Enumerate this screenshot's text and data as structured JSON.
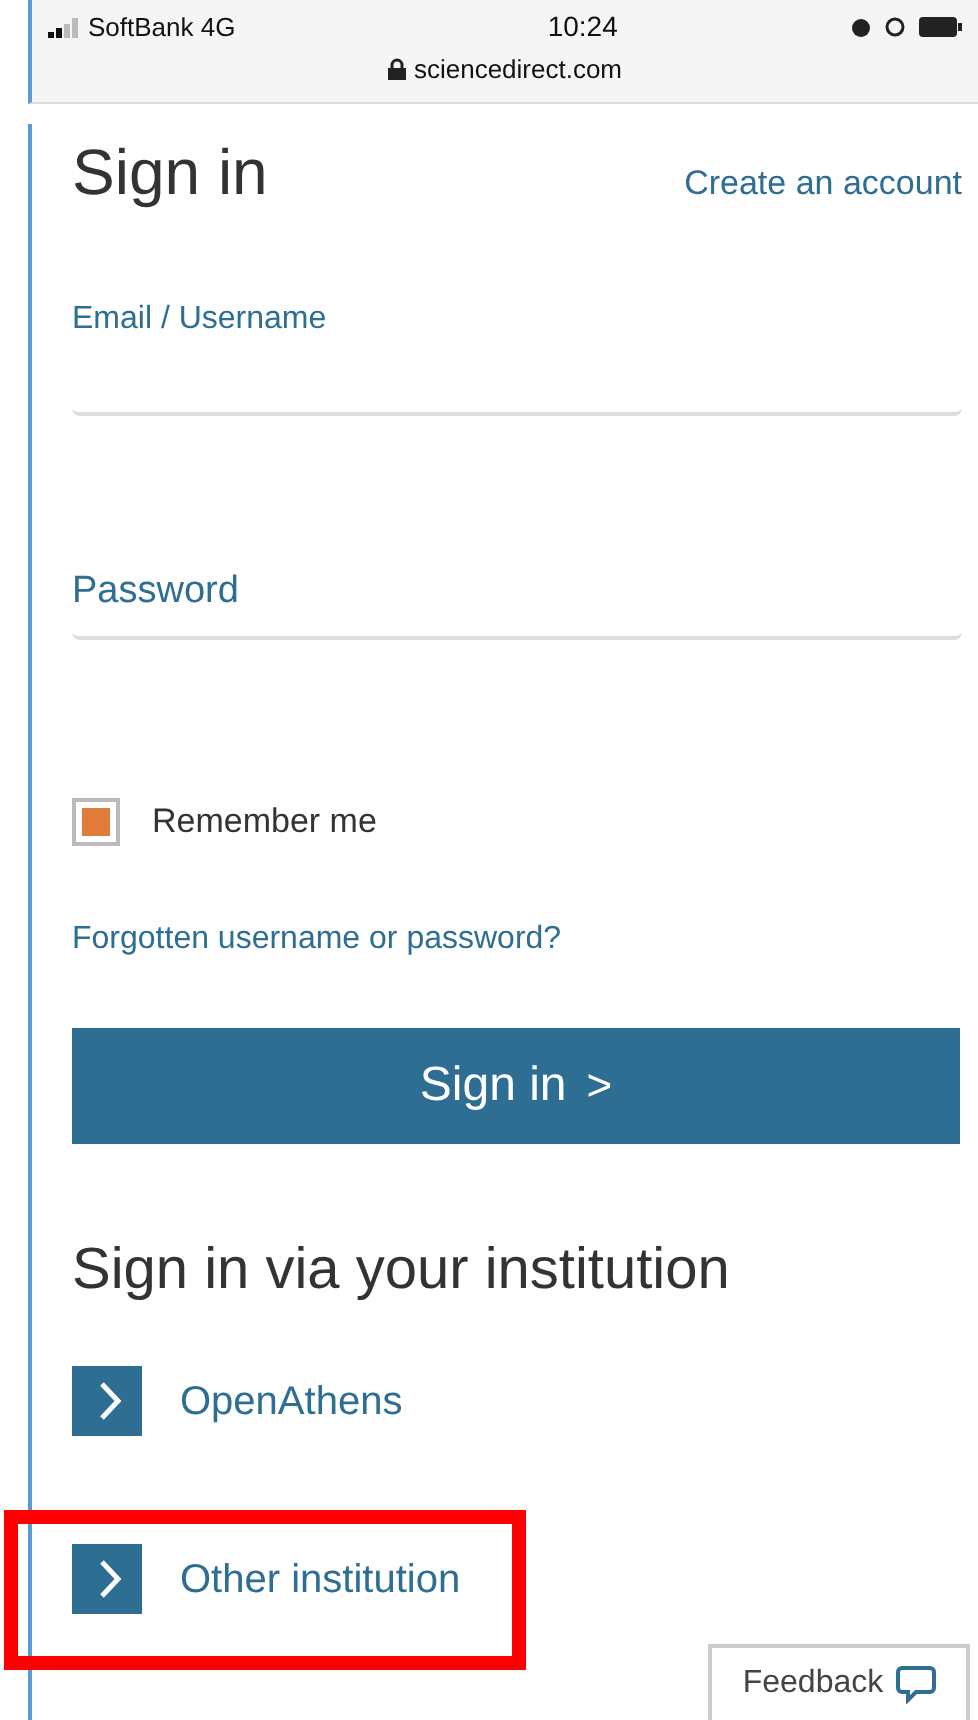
{
  "status_bar": {
    "carrier": "SoftBank 4G",
    "time": "10:24",
    "url": "sciencedirect.com"
  },
  "title": "Sign in",
  "create_account": "Create an account",
  "fields": [
    {
      "label": "Email / Username",
      "kind": "email"
    },
    {
      "label": "Password",
      "kind": "password"
    }
  ],
  "remember": {
    "label": "Remember me",
    "checked": true
  },
  "forgot": "Forgotten username or password?",
  "submit": {
    "label": "Sign in",
    "arrow": ">"
  },
  "institution_heading": "Sign in via your institution",
  "institutions": [
    {
      "label": "OpenAthens",
      "highlighted": false
    },
    {
      "label": "Other institution",
      "highlighted": true
    }
  ],
  "feedback": "Feedback"
}
